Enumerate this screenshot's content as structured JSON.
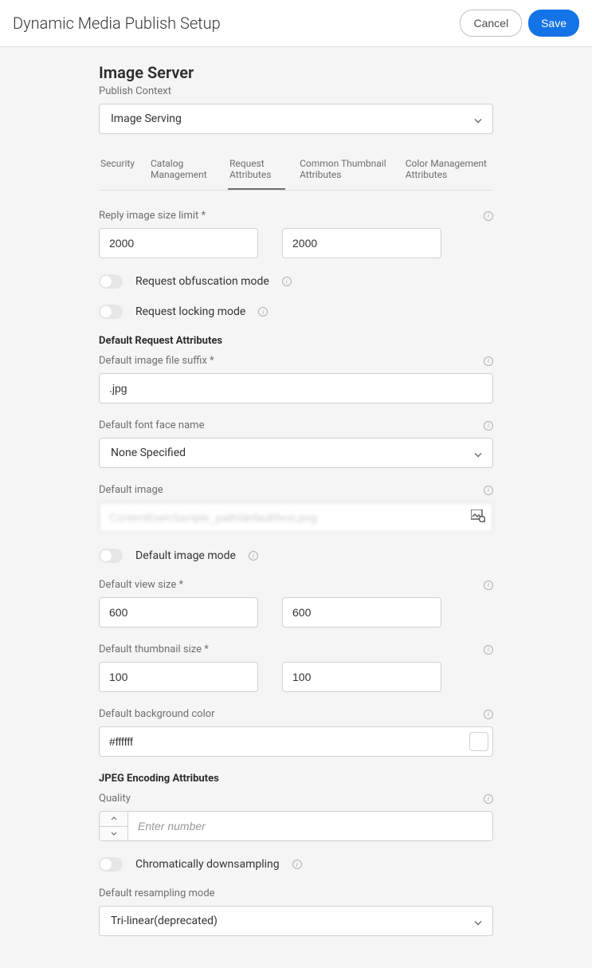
{
  "header": {
    "title": "Dynamic Media Publish Setup",
    "cancel": "Cancel",
    "save": "Save"
  },
  "section": {
    "title": "Image Server",
    "context_label": "Publish Context",
    "context_value": "Image Serving"
  },
  "tabs": {
    "security": "Security",
    "catalog": "Catalog Management",
    "request": "Request Attributes",
    "thumbnail": "Common Thumbnail Attributes",
    "color": "Color Management Attributes"
  },
  "reply_size": {
    "label": "Reply image size limit *",
    "width": "2000",
    "height": "2000"
  },
  "obfuscation": {
    "label": "Request obfuscation mode"
  },
  "locking": {
    "label": "Request locking mode"
  },
  "default_req": {
    "header": "Default Request Attributes",
    "suffix_label": "Default image file suffix *",
    "suffix_value": ".jpg",
    "font_label": "Default font face name",
    "font_value": "None Specified",
    "image_label": "Default image",
    "image_value": "ContentDamSample_path/default/test.png",
    "image_mode_label": "Default image mode",
    "view_size_label": "Default view size *",
    "view_width": "600",
    "view_height": "600",
    "thumb_size_label": "Default thumbnail size *",
    "thumb_width": "100",
    "thumb_height": "100",
    "bg_label": "Default background color",
    "bg_value": "#ffffff"
  },
  "jpeg": {
    "header": "JPEG Encoding Attributes",
    "quality_label": "Quality",
    "quality_placeholder": "Enter number",
    "downsample_label": "Chromatically downsampling",
    "resample_label": "Default resampling mode",
    "resample_value": "Tri-linear(deprecated)"
  }
}
